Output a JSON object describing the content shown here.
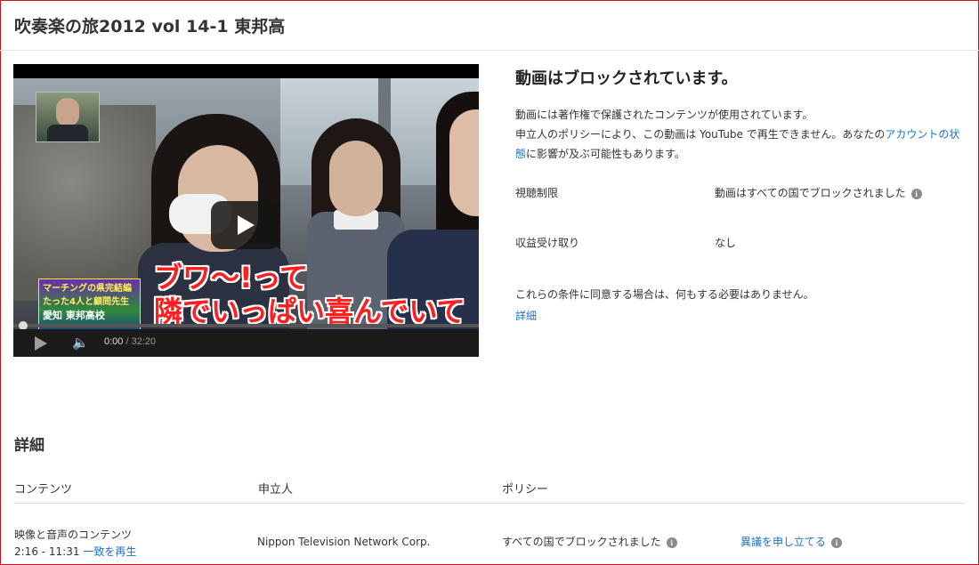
{
  "page": {
    "title": "吹奏楽の旅2012 vol 14-1 東邦高"
  },
  "player": {
    "overlay": {
      "inset_badge_line1": "マーチングの県完結編",
      "inset_badge_line2": "たった4人と顧問先生",
      "inset_badge_line3": "愛知 東邦高校",
      "caption_line1": "ブワ〜!って",
      "caption_line2": "隣でいっぱい喜んでいて"
    },
    "time_current": "0:00",
    "time_separator": " / ",
    "time_total": "32:20"
  },
  "block_info": {
    "heading": "動画はブロックされています。",
    "desc_line1": "動画には著作権で保護されたコンテンツが使用されています。",
    "desc_line2_prefix": "申立人のポリシーにより、この動画は YouTube で再生できません。あなたの",
    "desc_link": "アカウントの状態",
    "desc_line2_suffix": "に影響が及ぶ可能性もあります。",
    "rows": [
      {
        "label": "視聴制限",
        "value": "動画はすべての国でブロックされました"
      },
      {
        "label": "収益受け取り",
        "value": "なし"
      }
    ],
    "condition_text": "これらの条件に同意する場合は、何もする必要はありません。",
    "details_link": "詳細"
  },
  "details": {
    "title": "詳細",
    "headers": {
      "content": "コンテンツ",
      "claimant": "申立人",
      "policy": "ポリシー"
    },
    "row": {
      "content_type": "映像と音声のコンテンツ",
      "time_range": "2:16 - 11:31",
      "play_match_link": "一致を再生",
      "claimant": "Nippon Television Network Corp.",
      "policy": "すべての国でブロックされました",
      "dispute_link": "異議を申し立てる"
    }
  },
  "icons": {
    "info": "info-icon",
    "play": "play-icon",
    "volume": "volume-icon"
  },
  "colors": {
    "link": "#1a73c8",
    "caption_red": "#ff1f1f",
    "frame_border": "#c8151b"
  }
}
